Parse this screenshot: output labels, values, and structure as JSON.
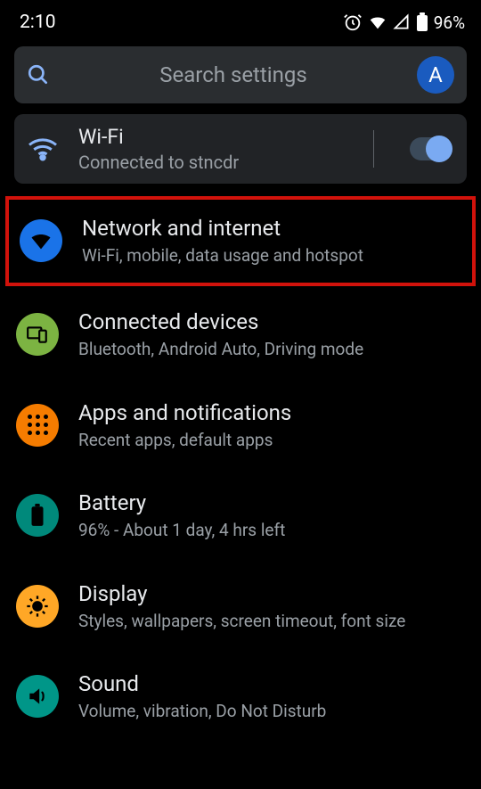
{
  "status": {
    "time": "2:10",
    "battery_pct": "96%"
  },
  "search": {
    "placeholder": "Search settings",
    "avatar_letter": "A"
  },
  "wifi_card": {
    "title": "Wi-Fi",
    "subtitle": "Connected to stncdr",
    "toggle_on": true
  },
  "items": [
    {
      "title": "Network and internet",
      "subtitle": "Wi-Fi, mobile, data usage and hotspot",
      "highlighted": true
    },
    {
      "title": "Connected devices",
      "subtitle": "Bluetooth, Android Auto, Driving mode"
    },
    {
      "title": "Apps and notifications",
      "subtitle": "Recent apps, default apps"
    },
    {
      "title": "Battery",
      "subtitle": "96% - About 1 day, 4 hrs left"
    },
    {
      "title": "Display",
      "subtitle": "Styles, wallpapers, screen timeout, font size"
    },
    {
      "title": "Sound",
      "subtitle": "Volume, vibration, Do Not Disturb"
    }
  ]
}
